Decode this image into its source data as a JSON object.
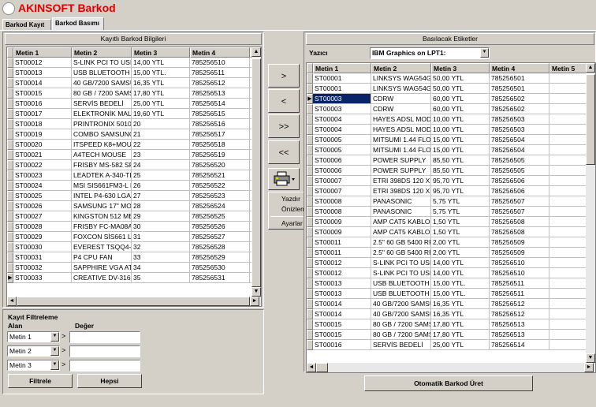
{
  "app": {
    "title": "AKINSOFT Barkod"
  },
  "tabs": [
    "Barkod Kayıt",
    "Barkod Basımı"
  ],
  "left": {
    "caption": "Kayıtlı Barkod Bilgileri",
    "columns": [
      "Metin 1",
      "Metin 2",
      "Metin 3",
      "Metin 4",
      "M"
    ],
    "rows": [
      [
        "ST00012",
        "S-LINK PCI TO USB",
        "14,00 YTL",
        "785256510"
      ],
      [
        "ST00013",
        "USB BLUETOOTH D",
        "15,00 YTL.",
        "785256511"
      ],
      [
        "ST00014",
        "40 GB/7200 SAMSU",
        "16,35 YTL",
        "785256512"
      ],
      [
        "ST00015",
        "80 GB / 7200 SAMS",
        "17,80 YTL",
        "785256513"
      ],
      [
        "ST00016",
        "SERVİS BEDELİ",
        "25,00 YTL",
        "785256514"
      ],
      [
        "ST00017",
        "ELEKTRONİK MALZ",
        "19,60 YTL",
        "785256515"
      ],
      [
        "ST00018",
        "PRINTRONIX 5010",
        "20",
        "785256516"
      ],
      [
        "ST00019",
        "COMBO SAMSUNG",
        "21",
        "785256517"
      ],
      [
        "ST00020",
        "ITSPEED K8+MOUS",
        "22",
        "785256518"
      ],
      [
        "ST00021",
        "A4TECH MOUSE",
        "23",
        "785256519"
      ],
      [
        "ST00022",
        "FRISBY MS-582 SPE",
        "24",
        "785256520"
      ],
      [
        "ST00023",
        "LEADTEK A-340-TD",
        "25",
        "785256521"
      ],
      [
        "ST00024",
        "MSI SIS661FM3-L LA",
        "26",
        "785256522"
      ],
      [
        "ST00025",
        "INTEL P4-630 LGA7",
        "27",
        "785256523"
      ],
      [
        "ST00026",
        "SAMSUNG 17\" MON",
        "28",
        "785256524"
      ],
      [
        "ST00027",
        "KINGSTON 512 MB",
        "29",
        "785256525"
      ],
      [
        "ST00028",
        "FRISBY FC-MA08A B",
        "30",
        "785256526"
      ],
      [
        "ST00029",
        "FOXCON SİS661 LG",
        "31",
        "785256527"
      ],
      [
        "ST00030",
        "EVEREST TSQQ4-1",
        "32",
        "785256528"
      ],
      [
        "ST00031",
        "P4 CPU FAN",
        "33",
        "785256529"
      ],
      [
        "ST00032",
        "SAPPHIRE VGA ATI",
        "34",
        "785256530"
      ],
      [
        "ST00033",
        "CREATIVE DV-316 6",
        "35",
        "785256531"
      ]
    ]
  },
  "filter": {
    "title": "Kayıt Filtreleme",
    "alan_label": "Alan",
    "deger_label": "Değer",
    "fields": [
      "Metin 1",
      "Metin 2",
      "Metin 3"
    ],
    "gt": ">",
    "filter_button": "Filtrele",
    "all_button": "Hepsi"
  },
  "nav": {
    "move_right": ">",
    "move_left": "<",
    "move_all_right": ">>",
    "move_all_left": "<<"
  },
  "print_menu": {
    "print": "Yazdır",
    "preview": "Önizleme Yap",
    "settings": "Ayarlar"
  },
  "right": {
    "caption": "Basılacak Etiketler",
    "printer_label": "Yazıcı",
    "printer_value": "IBM Graphics on LPT1:",
    "columns": [
      "Metin 1",
      "Metin 2",
      "Metin 3",
      "Metin 4",
      "Metin 5"
    ],
    "rows": [
      [
        "ST00001",
        "LINKSYS WAG54G",
        "50,00 YTL",
        "785256501"
      ],
      [
        "ST00001",
        "LINKSYS WAG54G",
        "50,00 YTL",
        "785256501"
      ],
      [
        "ST00003",
        "CDRW",
        "60,00 YTL",
        "785256502"
      ],
      [
        "ST00003",
        "CDRW",
        "60,00 YTL",
        "785256502"
      ],
      [
        "ST00004",
        "HAYES ADSL MODE",
        "10,00 YTL",
        "785256503"
      ],
      [
        "ST00004",
        "HAYES ADSL MODE",
        "10,00 YTL",
        "785256503"
      ],
      [
        "ST00005",
        "MITSUMI 1.44 FLOP",
        "15,00 YTL",
        "785256504"
      ],
      [
        "ST00005",
        "MITSUMI 1.44 FLOP",
        "15,00 YTL",
        "785256504"
      ],
      [
        "ST00006",
        "POWER SUPPLY",
        "85,50 YTL",
        "785256505"
      ],
      [
        "ST00006",
        "POWER SUPPLY",
        "85,50 YTL",
        "785256505"
      ],
      [
        "ST00007",
        "ETRI 398DS 120 X",
        "95,70 YTL",
        "785256506"
      ],
      [
        "ST00007",
        "ETRI 398DS 120 X",
        "95,70 YTL",
        "785256506"
      ],
      [
        "ST00008",
        "PANASONIC",
        "5,75 YTL",
        "785256507"
      ],
      [
        "ST00008",
        "PANASONIC",
        "5,75 YTL",
        "785256507"
      ],
      [
        "ST00009",
        "AMP CAT5 KABLO",
        "1,50 YTL",
        "785256508"
      ],
      [
        "ST00009",
        "AMP CAT5 KABLO",
        "1,50 YTL",
        "785256508"
      ],
      [
        "ST00011",
        "2.5\" 60 GB 5400 RP",
        "2,00 YTL",
        "785256509"
      ],
      [
        "ST00011",
        "2.5\" 60 GB 5400 RP",
        "2,00 YTL",
        "785256509"
      ],
      [
        "ST00012",
        "S-LINK PCI TO USB",
        "14,00 YTL",
        "785256510"
      ],
      [
        "ST00012",
        "S-LINK PCI TO USB",
        "14,00 YTL",
        "785256510"
      ],
      [
        "ST00013",
        "USB BLUETOOTH D",
        "15,00 YTL.",
        "785256511"
      ],
      [
        "ST00013",
        "USB BLUETOOTH D",
        "15,00 YTL.",
        "785256511"
      ],
      [
        "ST00014",
        "40 GB/7200 SAMSU",
        "16,35 YTL",
        "785256512"
      ],
      [
        "ST00014",
        "40 GB/7200 SAMSU",
        "16,35 YTL",
        "785256512"
      ],
      [
        "ST00015",
        "80 GB / 7200 SAMS",
        "17,80 YTL",
        "785256513"
      ],
      [
        "ST00015",
        "80 GB / 7200 SAMS",
        "17,80 YTL",
        "785256513"
      ],
      [
        "ST00016",
        "SERVİS BEDELİ",
        "25,00 YTL",
        "785256514"
      ]
    ]
  },
  "auto_button": "Otomatik Barkod Üret",
  "colors": {
    "title_red": "#e00000",
    "selection": "#0a246a",
    "face": "#d4d0c8"
  }
}
